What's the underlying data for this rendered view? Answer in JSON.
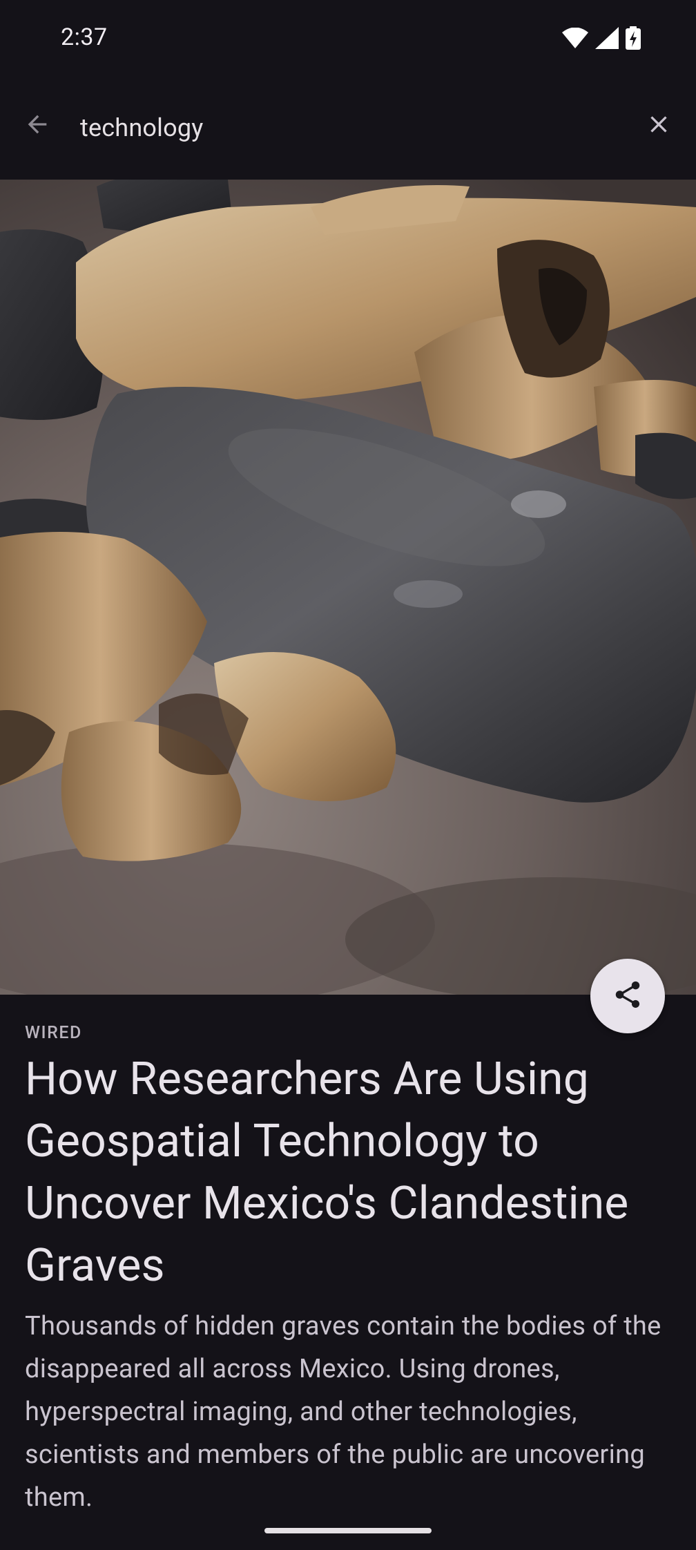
{
  "status_bar": {
    "time": "2:37",
    "icons": [
      "wifi-icon",
      "signal-icon",
      "battery-charging-icon"
    ]
  },
  "search": {
    "query": "technology",
    "back_icon": "arrow-left-icon",
    "clear_icon": "close-icon"
  },
  "article": {
    "source": "WIRED",
    "title": "How Researchers Are Using Geospatial Technology to Uncover Mexico's Clandestine Graves",
    "summary": "Thousands of hidden graves contain the bodies of the disappeared all across Mexico. Using drones, hyperspectral imaging, and other technologies, scientists and members of the public are uncovering them.",
    "share_icon": "share-icon"
  },
  "colors": {
    "background": "#141218",
    "text_primary": "#e8e3ea",
    "text_secondary": "#cac4cf",
    "fab_background": "#e8e3eb"
  }
}
